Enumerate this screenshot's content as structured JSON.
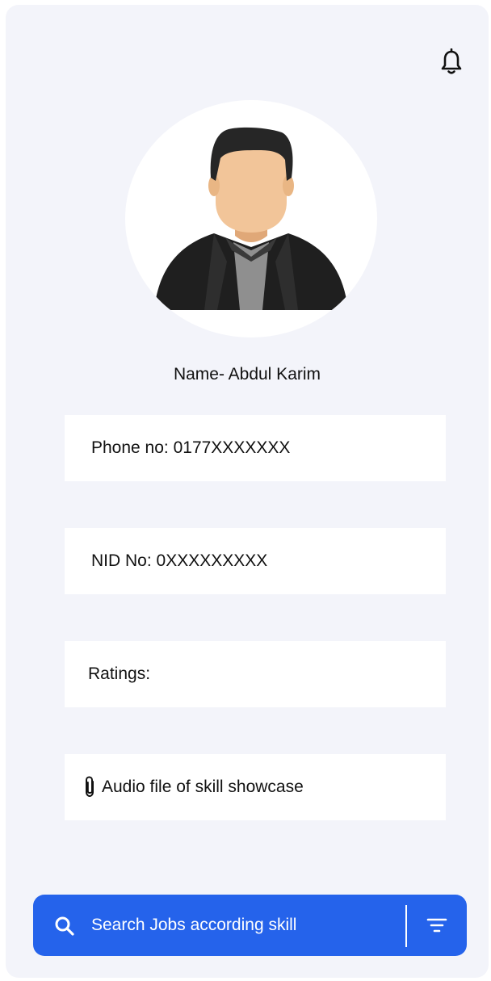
{
  "header": {
    "notification_icon": "bell-icon"
  },
  "profile": {
    "avatar_icon": "user-avatar",
    "name": "Name- Abdul Karim",
    "phone": "Phone no: 0177XXXXXXX",
    "nid": "NID No: 0XXXXXXXXX",
    "ratings": "Ratings:",
    "audio_label": "Audio file of skill showcase",
    "audio_icon": "paperclip-icon"
  },
  "search": {
    "placeholder": "Search Jobs according skill",
    "search_icon": "search-icon",
    "filter_icon": "filter-icon"
  },
  "colors": {
    "background": "#f3f4fa",
    "card": "#ffffff",
    "accent": "#2563eb",
    "text": "#111111"
  }
}
